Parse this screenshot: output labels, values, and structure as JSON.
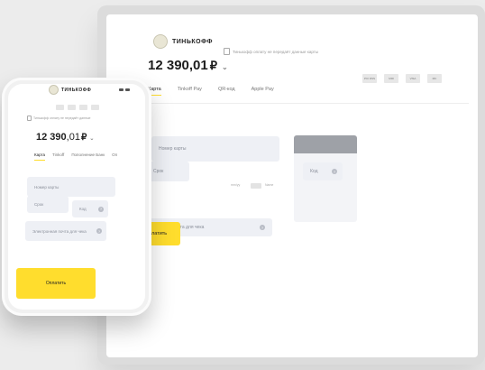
{
  "brand": {
    "logo_text": "ТИНЬКОФФ"
  },
  "desktop": {
    "secure_note": "Тинькофф оплату не передаёт данные карты",
    "balance": {
      "amount": "12 390,01",
      "currency": "₽"
    },
    "badges": [
      "PCI DSS",
      "MIR",
      "VISA",
      "MC"
    ],
    "tabs": [
      "Карта",
      "Tinkoff Pay",
      "QR-код",
      "Apple Pay"
    ],
    "card_number_placeholder": "Номер карты",
    "date_placeholder": "Срок",
    "cvc_placeholder": "Код",
    "tiny_left": "mm/yy",
    "tiny_right": "Name",
    "email_placeholder": "Электронная почта для чека",
    "pay_button": "Оплатить"
  },
  "phone": {
    "secure_note": "Тинькофф оплату не передаёт данные",
    "balance": {
      "amount": "12 390",
      "cents": ",01",
      "currency": "₽"
    },
    "tabs": [
      "Карта",
      "Tinkoff",
      "Пополнение Банк",
      "Оп"
    ],
    "card_number_placeholder": "Номер карты",
    "date_placeholder": "Срок",
    "cvc_placeholder": "Код",
    "email_placeholder": "Электронная почта для чека",
    "pay_button": "Оплатить"
  },
  "icons": {
    "info": "info-icon",
    "lock": "lock-icon",
    "chevron": "chevron-down-icon"
  },
  "colors": {
    "accent": "#ffdd2d",
    "field_bg": "#eef0f5",
    "text_dark": "#1e1e1e"
  }
}
